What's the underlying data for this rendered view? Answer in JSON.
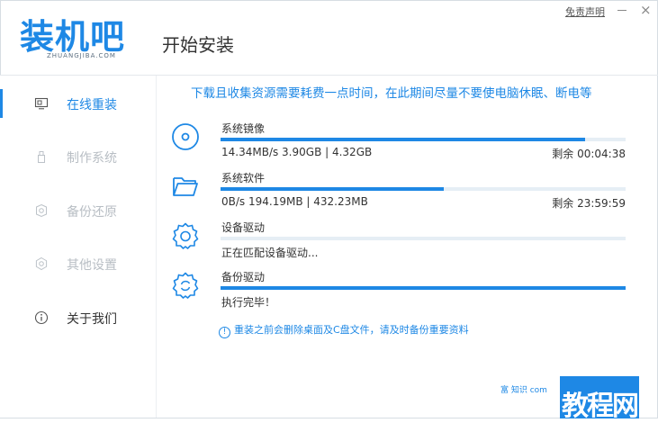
{
  "brand": {
    "logo_text": "装机吧",
    "logo_domain": "ZHUANGJIBA.COM"
  },
  "header": {
    "title": "开始安装",
    "disclaimer": "免责声明",
    "close_glyph": "×"
  },
  "sidebar": {
    "items": [
      {
        "label": "在线重装",
        "icon": "monitor-icon",
        "state": "active"
      },
      {
        "label": "制作系统",
        "icon": "usb-icon",
        "state": "disabled"
      },
      {
        "label": "备份还原",
        "icon": "backup-icon",
        "state": "disabled"
      },
      {
        "label": "其他设置",
        "icon": "settings-icon",
        "state": "disabled"
      },
      {
        "label": "关于我们",
        "icon": "info-icon",
        "state": "normal"
      }
    ]
  },
  "main": {
    "notice": "下载且收集资源需要耗费一点时间，在此期间尽量不要使电脑休眠、断电等",
    "tasks": [
      {
        "name": "系统镜像",
        "icon": "disc-icon",
        "progress": 0.9,
        "info": "14.34MB/s 3.90GB | 4.32GB",
        "remaining": "剩余 00:04:38"
      },
      {
        "name": "系统软件",
        "icon": "folder-icon",
        "progress": 0.55,
        "info": "0B/s 194.19MB | 432.23MB",
        "remaining": "剩余 23:59:59"
      },
      {
        "name": "设备驱动",
        "icon": "gear-icon",
        "progress": 0,
        "info": "正在匹配设备驱动...",
        "remaining": ""
      },
      {
        "name": "备份驱动",
        "icon": "gear-sync-icon",
        "progress": 1.0,
        "info": "执行完毕！",
        "remaining": ""
      }
    ],
    "warning_icon": "!",
    "warning": "重装之前会删除桌面及C盘文件，请及时备份重要资料"
  },
  "watermark": {
    "small_text": "富 知识 com",
    "big_text": "教程网"
  },
  "colors": {
    "accent": "#1e88e5",
    "track": "#e6eef5",
    "disabled": "#b8bec4"
  }
}
